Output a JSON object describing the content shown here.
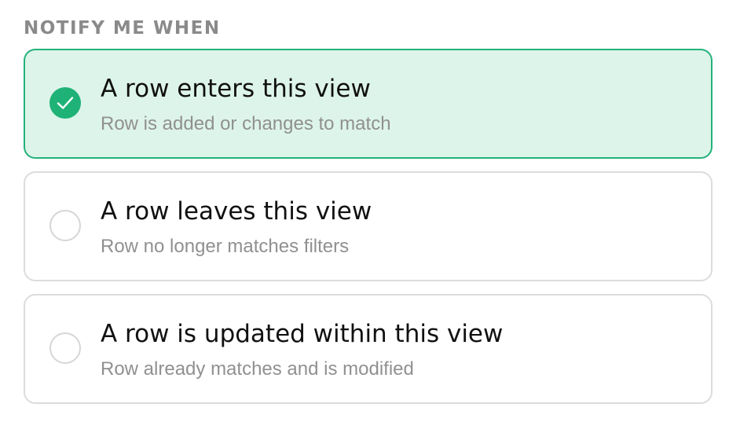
{
  "section": {
    "label": "NOTIFY ME WHEN"
  },
  "options": [
    {
      "title": "A row enters this view",
      "description": "Row is added or changes to match",
      "selected": true
    },
    {
      "title": "A row leaves this view",
      "description": "Row no longer matches filters",
      "selected": false
    },
    {
      "title": "A row is updated within this view",
      "description": "Row already matches and is modified",
      "selected": false
    }
  ],
  "colors": {
    "accent": "#1fb277",
    "selected_background": "#ddf4ea",
    "selected_border": "#23b27a",
    "unselected_border": "#dcdcdc",
    "label_text": "#8a8a8a",
    "description_text": "#909090"
  },
  "icons": {
    "selected": "check-icon",
    "unselected": "empty-radio-icon"
  }
}
